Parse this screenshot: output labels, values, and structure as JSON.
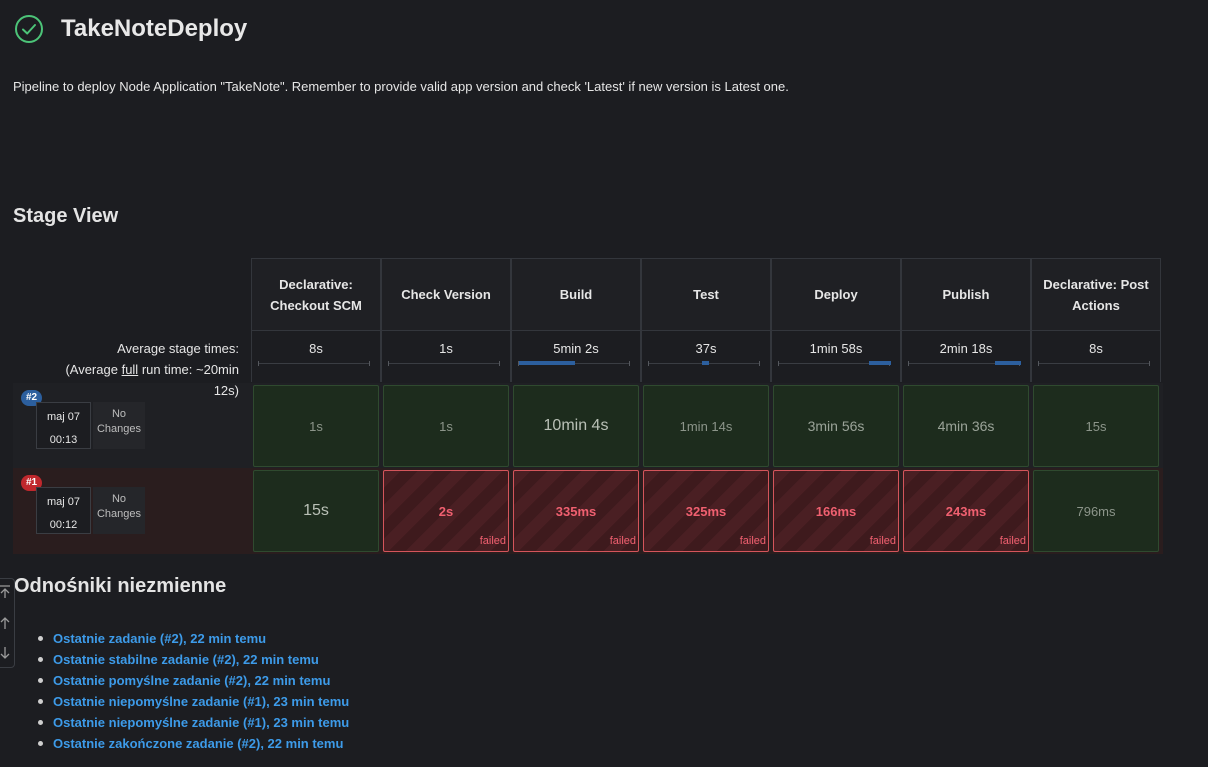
{
  "header": {
    "title": "TakeNoteDeploy",
    "status_icon": "check-circle-icon",
    "status_color": "#4cc478",
    "description": "Pipeline to deploy Node Application \"TakeNote\". Remember to provide valid app version and check 'Latest' if new version is Latest one."
  },
  "stage_view": {
    "title": "Stage View",
    "avg_label_line1": "Average stage times:",
    "avg_label_pre": "(Average ",
    "avg_label_full": "full",
    "avg_label_post": " run time: ~20min",
    "avg_label_line3": "12s)",
    "stages": [
      {
        "name": "Declarative: Checkout SCM",
        "avg": "8s",
        "avg_fraction": 0.0
      },
      {
        "name": "Check Version",
        "avg": "1s",
        "avg_fraction": 0.0
      },
      {
        "name": "Build",
        "avg": "5min 2s",
        "avg_fraction": 0.5
      },
      {
        "name": "Test",
        "avg": "37s",
        "avg_fraction": 0.06
      },
      {
        "name": "Deploy",
        "avg": "1min 58s",
        "avg_fraction": 0.2
      },
      {
        "name": "Publish",
        "avg": "2min 18s",
        "avg_fraction": 0.23
      },
      {
        "name": "Declarative: Post Actions",
        "avg": "8s",
        "avg_fraction": 0.0
      }
    ],
    "runs": [
      {
        "badge": "#2",
        "status": "success",
        "date": "maj 07",
        "time": "00:13",
        "changes": "No Changes",
        "cells": [
          {
            "value": "1s",
            "status": "success"
          },
          {
            "value": "1s",
            "status": "success"
          },
          {
            "value": "10min 4s",
            "status": "success"
          },
          {
            "value": "1min 14s",
            "status": "success"
          },
          {
            "value": "3min 56s",
            "status": "success"
          },
          {
            "value": "4min 36s",
            "status": "success"
          },
          {
            "value": "15s",
            "status": "success"
          }
        ]
      },
      {
        "badge": "#1",
        "status": "failed",
        "date": "maj 07",
        "time": "00:12",
        "changes": "No Changes",
        "cells": [
          {
            "value": "15s",
            "status": "success"
          },
          {
            "value": "2s",
            "status": "failed"
          },
          {
            "value": "335ms",
            "status": "failed"
          },
          {
            "value": "325ms",
            "status": "failed"
          },
          {
            "value": "166ms",
            "status": "failed"
          },
          {
            "value": "243ms",
            "status": "failed"
          },
          {
            "value": "796ms",
            "status": "success"
          }
        ]
      }
    ],
    "failed_label": "failed"
  },
  "permalinks": {
    "title": "Odnośniki niezmienne",
    "items": [
      "Ostatnie zadanie (#2), 22 min temu",
      "Ostatnie stabilne zadanie (#2), 22 min temu",
      "Ostatnie pomyślne zadanie (#2), 22 min temu",
      "Ostatnie niepomyślne zadanie (#1), 23 min temu",
      "Ostatnie niepomyślne zadanie (#1), 23 min temu",
      "Ostatnie zakończone zadanie (#2), 22 min temu"
    ]
  },
  "scroll_controls": [
    "scroll-top-icon",
    "scroll-up-icon",
    "scroll-down-icon"
  ]
}
